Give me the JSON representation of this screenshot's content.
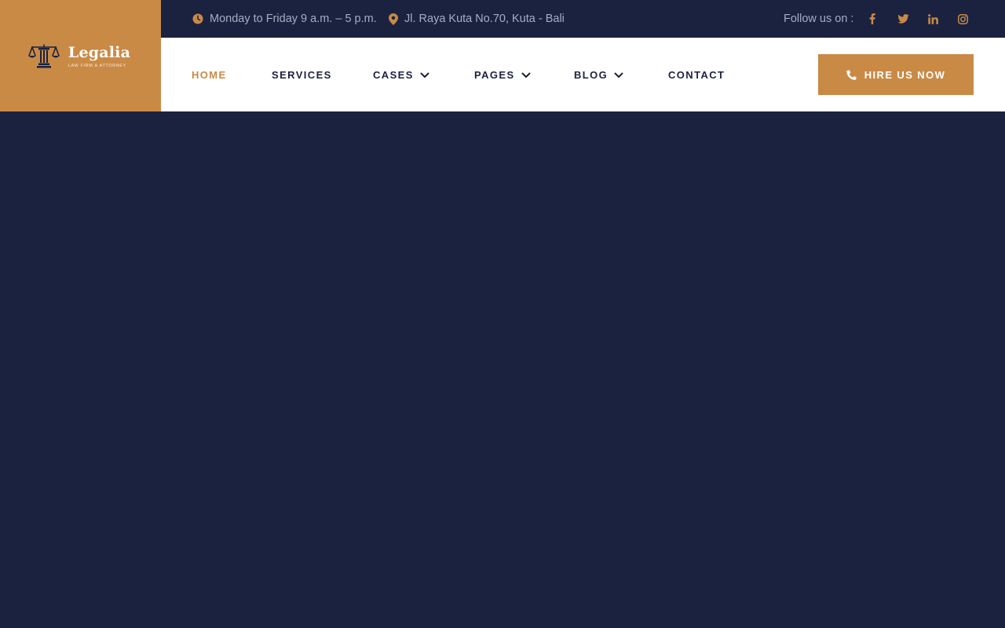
{
  "colors": {
    "accent": "#c98a46",
    "dark": "#1b2240",
    "muted_text": "#a6acc4"
  },
  "brand": {
    "name": "Legalia",
    "tagline": "LAW FIRM & ATTORNEY",
    "logo_icon": "scales-of-justice-icon"
  },
  "topbar": {
    "hours": {
      "icon": "clock-icon",
      "text": "Monday to Friday 9 a.m. – 5 p.m."
    },
    "address": {
      "icon": "map-pin-icon",
      "text": "Jl. Raya Kuta No.70, Kuta - Bali"
    },
    "follow_label": "Follow us on :",
    "social": [
      {
        "name": "facebook",
        "icon": "facebook-icon"
      },
      {
        "name": "twitter",
        "icon": "twitter-icon"
      },
      {
        "name": "linkedin",
        "icon": "linkedin-icon"
      },
      {
        "name": "instagram",
        "icon": "instagram-icon"
      }
    ]
  },
  "nav": {
    "items": [
      {
        "label": "HOME",
        "active": true,
        "dropdown": false
      },
      {
        "label": "SERVICES",
        "active": false,
        "dropdown": false
      },
      {
        "label": "CASES",
        "active": false,
        "dropdown": true
      },
      {
        "label": "PAGES",
        "active": false,
        "dropdown": true
      },
      {
        "label": "BLOG",
        "active": false,
        "dropdown": true
      },
      {
        "label": "CONTACT",
        "active": false,
        "dropdown": false
      }
    ],
    "cta": {
      "label": "HIRE US NOW",
      "icon": "phone-icon"
    }
  }
}
